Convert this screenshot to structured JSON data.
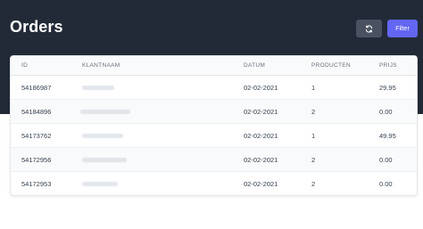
{
  "header": {
    "title": "Orders",
    "filter_label": "Filter",
    "refresh_icon": "refresh-icon"
  },
  "table": {
    "columns": [
      "ID",
      "KLANTNAAM",
      "DATUM",
      "PRODUCTEN",
      "PRIJS"
    ],
    "rows": [
      {
        "id": "54186987",
        "name": "",
        "date": "02-02-2021",
        "products": "1",
        "price": "29.95"
      },
      {
        "id": "54184896",
        "name": "",
        "date": "02-02-2021",
        "products": "2",
        "price": "0.00"
      },
      {
        "id": "54173762",
        "name": "",
        "date": "02-02-2021",
        "products": "1",
        "price": "49.95"
      },
      {
        "id": "54172956",
        "name": "",
        "date": "02-02-2021",
        "products": "2",
        "price": "0.00"
      },
      {
        "id": "54172953",
        "name": "",
        "date": "02-02-2021",
        "products": "2",
        "price": "0.00"
      }
    ]
  },
  "colors": {
    "header_bg": "#222a37",
    "accent": "#6366f1",
    "secondary_button": "#4a5261"
  }
}
